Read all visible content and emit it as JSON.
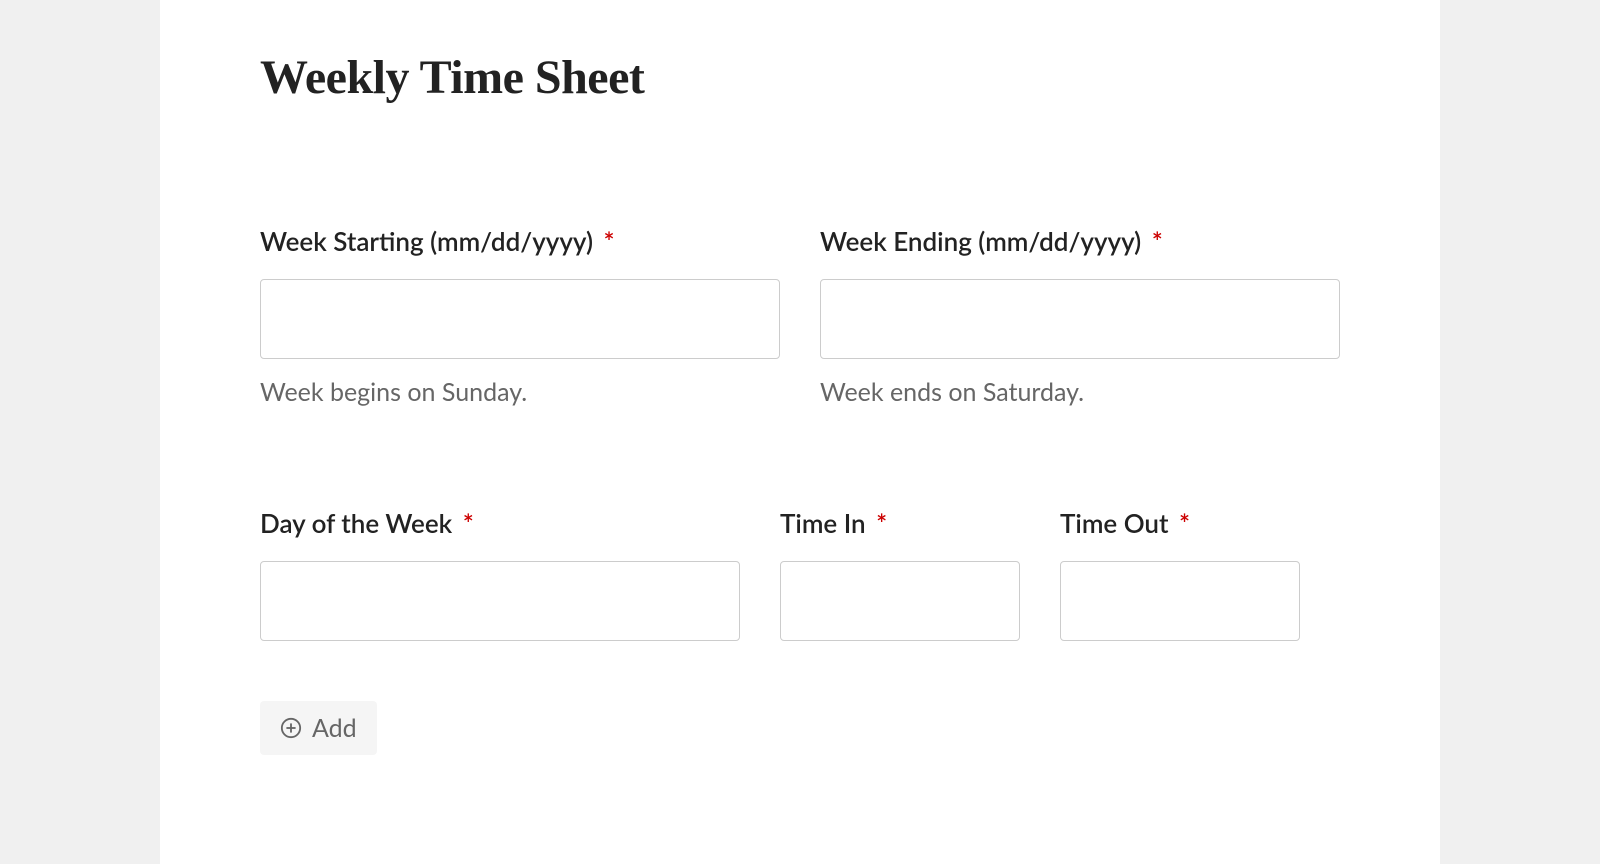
{
  "form": {
    "title": "Weekly Time Sheet",
    "required_mark": "*",
    "fields": {
      "week_starting": {
        "label": "Week Starting (mm/dd/yyyy)",
        "helper": "Week begins on Sunday.",
        "value": ""
      },
      "week_ending": {
        "label": "Week Ending (mm/dd/yyyy)",
        "helper": "Week ends on Saturday.",
        "value": ""
      },
      "day_of_week": {
        "label": "Day of the Week",
        "value": ""
      },
      "time_in": {
        "label": "Time In",
        "value": ""
      },
      "time_out": {
        "label": "Time Out",
        "value": ""
      }
    },
    "add_button_label": "Add"
  }
}
